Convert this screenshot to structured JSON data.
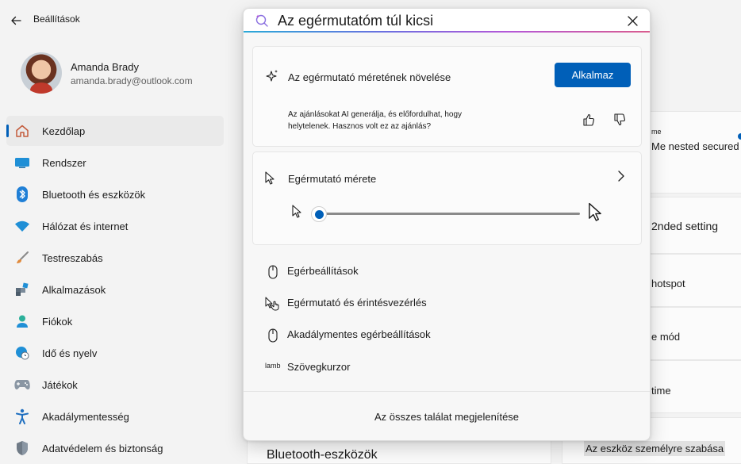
{
  "app": {
    "title": "Beállítások"
  },
  "profile": {
    "name": "Amanda Brady",
    "email": "amanda.brady@outlook.com"
  },
  "sidebar": {
    "items": [
      {
        "label": "Kezdőlap",
        "icon": "home-icon",
        "active": true
      },
      {
        "label": "Rendszer",
        "icon": "system-icon"
      },
      {
        "label": "Bluetooth és eszközök",
        "icon": "bluetooth-icon"
      },
      {
        "label": "Hálózat és internet",
        "icon": "wifi-icon"
      },
      {
        "label": "Testreszabás",
        "icon": "brush-icon"
      },
      {
        "label": "Alkalmazások",
        "icon": "apps-icon"
      },
      {
        "label": "Fiókok",
        "icon": "person-icon"
      },
      {
        "label": "Idő és nyelv",
        "icon": "clock-globe-icon"
      },
      {
        "label": "Játékok",
        "icon": "gamepad-icon"
      },
      {
        "label": "Akadálymentesség",
        "icon": "accessibility-icon"
      },
      {
        "label": "Adatvédelem és biztonság",
        "icon": "shield-icon"
      }
    ]
  },
  "background": {
    "partial_me": "me",
    "partial_nested": "Me nested secured",
    "partial_2nded": "2nded setting",
    "partial_hotspot": "hotspot",
    "partial_mod": "e mód",
    "partial_time": "time",
    "bluetooth_heading": "Bluetooth-eszközök",
    "customize_text": "Az eszköz személyre szabása"
  },
  "flyout": {
    "query": "Az egérmutatóm túl kicsi",
    "suggestion": {
      "title": "Az egérmutató méretének növelése",
      "apply_label": "Alkalmaz",
      "disclaimer": "Az ajánlásokat AI generálja, és előfordulhat, hogy helytelenek. Hasznos volt ez az ajánlás?"
    },
    "pointer_size": {
      "label": "Egérmutató mérete",
      "value": 0
    },
    "results": [
      {
        "label": "Egérbeállítások",
        "icon": "mouse-icon"
      },
      {
        "label": "Egérmutató és érintésvezérlés",
        "icon": "pointer-touch-icon"
      },
      {
        "label": "Akadálymentes egérbeállítások",
        "icon": "mouse-icon"
      },
      {
        "label": "Szövegkurzor",
        "icon": "text-cursor-icon",
        "tag": "lamb"
      }
    ],
    "footer_link": "Az összes találat megjelenítése"
  },
  "colors": {
    "accent": "#005fb8",
    "ai_gradient": [
      "#2aa9d8",
      "#6c6fe0",
      "#b458d8",
      "#d95c8e"
    ]
  }
}
